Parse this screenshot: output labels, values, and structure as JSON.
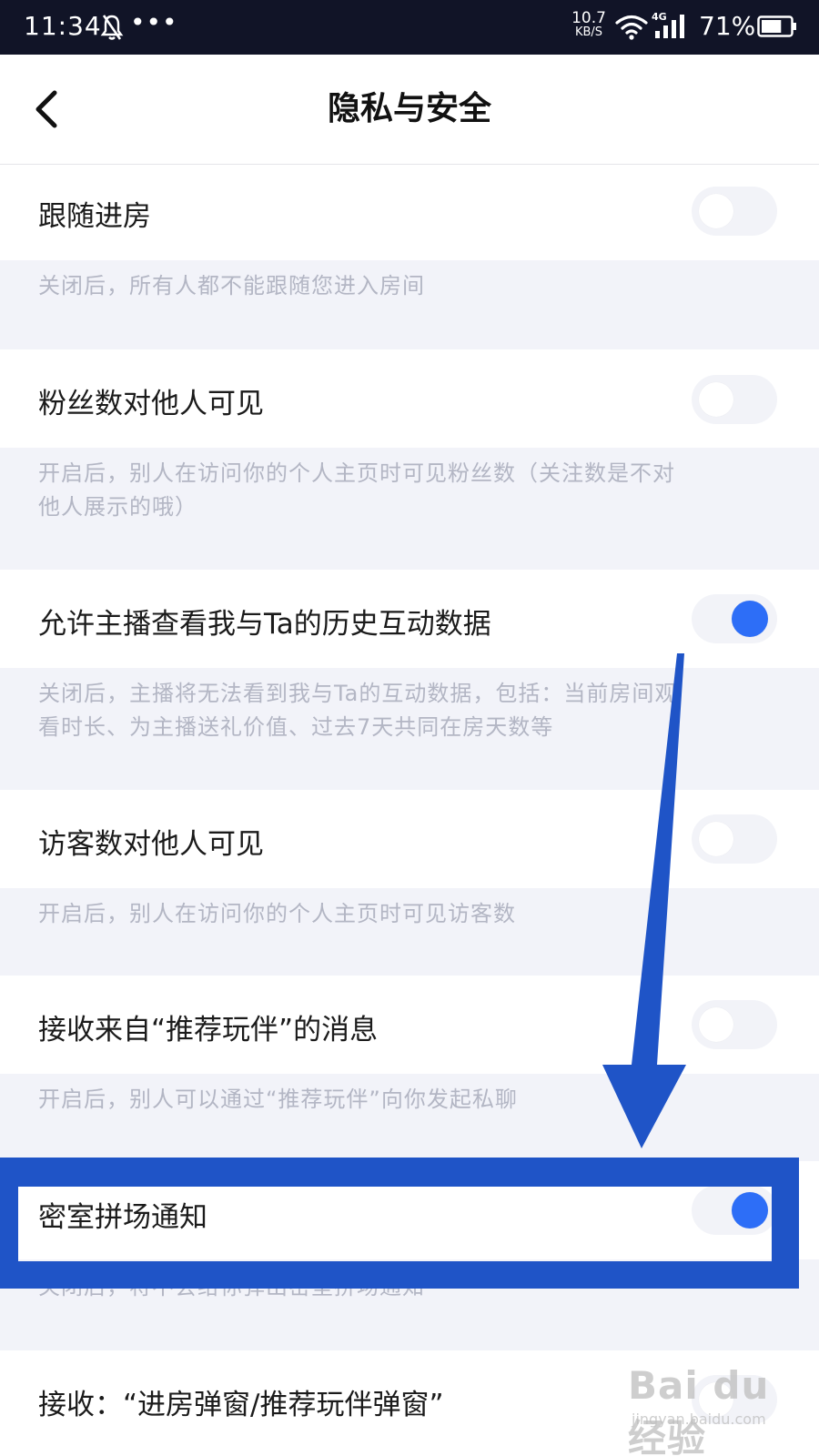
{
  "status_bar": {
    "time": "11:34",
    "more": "•••",
    "speed_value": "10.7",
    "speed_unit": "KB/S",
    "network": "4G",
    "battery_percent": "71%",
    "battery_level": 0.71
  },
  "header": {
    "title": "隐私与安全"
  },
  "settings": [
    {
      "label": "跟随进房",
      "enabled": false,
      "desc_lines": [
        "关闭后，所有人都不能跟随您进入房间"
      ]
    },
    {
      "label": "粉丝数对他人可见",
      "enabled": false,
      "desc_lines": [
        "开启后，别人在访问你的个人主页时可见粉丝数（关注数是不对",
        "他人展示的哦）"
      ]
    },
    {
      "label": "允许主播查看我与Ta的历史互动数据",
      "enabled": true,
      "desc_lines": [
        "关闭后，主播将无法看到我与Ta的互动数据，包括：当前房间观",
        "看时长、为主播送礼价值、过去7天共同在房天数等"
      ]
    },
    {
      "label": "访客数对他人可见",
      "enabled": false,
      "desc_lines": [
        "开启后，别人在访问你的个人主页时可见访客数"
      ]
    },
    {
      "label": "接收来自“推荐玩伴”的消息",
      "enabled": false,
      "desc_lines": [
        "开启后，别人可以通过“推荐玩伴”向你发起私聊"
      ]
    },
    {
      "label": "密室拼场通知",
      "enabled": true,
      "desc_lines": [
        "关闭后，将不会给你弹出密室拼场通知"
      ]
    },
    {
      "label": "接收：“进房弹窗/推荐玩伴弹窗”",
      "enabled": false,
      "desc_lines": []
    }
  ],
  "watermark": {
    "logo": "Bai du 经验",
    "sub": "jingyan.baidu.com"
  },
  "colors": {
    "accent": "#2d6ef7",
    "annotation": "#1f54c7",
    "status_bar": "#111427"
  }
}
